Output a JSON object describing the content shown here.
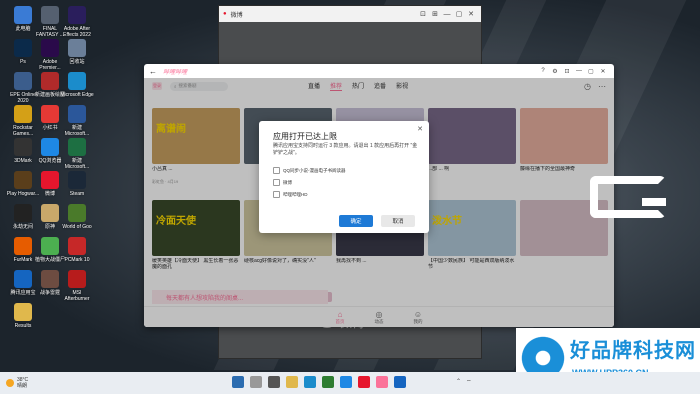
{
  "desktop": {
    "icons": [
      {
        "label": "此电脑",
        "color": "#3a7bd5"
      },
      {
        "label": "FINAL FANTASY ...",
        "color": "#556070"
      },
      {
        "label": "Adobe After Effects 2022",
        "color": "#2a1e5c"
      },
      {
        "label": "Ps",
        "sub": "Adobe Photosh...",
        "color": "#0b2a4a"
      },
      {
        "label": "Adobe Premier...",
        "color": "#2a0a4a"
      },
      {
        "label": "回收站",
        "color": "#6b7f99"
      },
      {
        "label": "EPE Online 2020",
        "color": "#3b5d8c"
      },
      {
        "label": "新建画板绘图",
        "color": "#b02a2a"
      },
      {
        "label": "Microsoft Edge",
        "color": "#1b8ccb"
      },
      {
        "label": "Rockstar Games...",
        "color": "#d4a017"
      },
      {
        "label": "小红书",
        "color": "#e53935"
      },
      {
        "label": "新建 Microsoft...",
        "color": "#2b579a"
      },
      {
        "label": "3DMark",
        "color": "#333333"
      },
      {
        "label": "QQ浏览器",
        "color": "#1e88e5"
      },
      {
        "label": "新建 Microsoft...",
        "color": "#1d6f42"
      },
      {
        "label": "Play Hogwar...",
        "color": "#5a3e1b"
      },
      {
        "label": "微博",
        "color": "#e6162d"
      },
      {
        "label": "Steam",
        "color": "#1b2838"
      },
      {
        "label": "永劫无间",
        "color": "#222222"
      },
      {
        "label": "原神",
        "color": "#c9a86a"
      },
      {
        "label": "World of Goo",
        "color": "#4a7a2a"
      },
      {
        "label": "FurMark",
        "color": "#e65c00"
      },
      {
        "label": "植物大战僵尸",
        "color": "#4caf50"
      },
      {
        "label": "PCMark 10",
        "color": "#c62828"
      },
      {
        "label": "腾讯应用宝",
        "color": "#1565c0"
      },
      {
        "label": "战争雷霆",
        "color": "#6d4c41"
      },
      {
        "label": "MSI Afterburner",
        "color": "#b71c1c"
      },
      {
        "label": "Results",
        "color": "#e0b84c"
      }
    ]
  },
  "weibo_window": {
    "title": "微博",
    "logo_text": "微博",
    "buttons": [
      "⊡",
      "⊞",
      "—",
      "▢",
      "✕"
    ]
  },
  "bili_window": {
    "title": "哔哩哔哩",
    "nav": {
      "avatar": "登录",
      "search_placeholder": "搜索番剧",
      "tabs": [
        "直播",
        "推荐",
        "热门",
        "追番",
        "影视"
      ],
      "active_tab": "推荐"
    },
    "cards": [
      {
        "cap": "离谱闹",
        "title": "小吕真 ...",
        "meta": "彩虹鱼 · 4月19",
        "bg": "#c8a060",
        "capcolor": "#ffdd00"
      },
      {
        "cap": "",
        "title": "",
        "meta": "",
        "bg": "#5a6670",
        "capcolor": "#fff"
      },
      {
        "cap": "",
        "title": "",
        "meta": "",
        "bg": "#c9c2d8",
        "capcolor": "#fff"
      },
      {
        "cap": "",
        "title": "...部 ... 啊",
        "meta": "",
        "bg": "#7a6a8a",
        "capcolor": "#fff"
      },
      {
        "cap": "",
        "title": "藤缘在播下的全国最神奇",
        "meta": "",
        "bg": "#e8b0a0",
        "capcolor": "#fff"
      },
      {
        "cap": "冷面天使",
        "title": "缓笑英雄【冷面天使】 黑生长着一张恶魔的面孔",
        "meta": "",
        "bg": "#3a4a2a",
        "capcolor": "#ffdd00"
      },
      {
        "cap": "",
        "title": "硬核acg好像说对了，确实没\"人\"",
        "meta": "",
        "bg": "#d0c8a0",
        "capcolor": "#fff"
      },
      {
        "cap": "",
        "title": "我再找不到 ...",
        "meta": "",
        "bg": "#3a3a4a",
        "capcolor": "#fff"
      },
      {
        "cap": "泼水节",
        "title": "【中国少数民族】 可能是西双版纳泼水节",
        "meta": "",
        "bg": "#b0c8d8",
        "capcolor": "#ffdd00"
      },
      {
        "cap": "",
        "title": "",
        "meta": "",
        "bg": "#d8c0c8",
        "capcolor": "#fff"
      },
      {
        "cap": "",
        "title": "",
        "meta": "",
        "bg": "#a0b0c0",
        "capcolor": "#fff"
      },
      {
        "cap": "",
        "title": "",
        "meta": "",
        "bg": "#e8c0d0",
        "capcolor": "#fff"
      }
    ],
    "banner": "每天都有人想攻陷我的阁桌...",
    "bottom_nav": [
      {
        "label": "首页",
        "icon": "⌂"
      },
      {
        "label": "动态",
        "icon": "◎"
      },
      {
        "label": "我的",
        "icon": "☺"
      }
    ]
  },
  "dialog": {
    "title": "应用打开已达上限",
    "body": "腾讯应用宝支持同时运行 3 款应用。请退出 1 款应用后再打开 \"金铲铲之战\"。",
    "options": [
      "QQ同步小说-漫画电子书阅读器",
      "微博",
      "哔哩哔哩HD"
    ],
    "ok": "确定",
    "cancel": "取消"
  },
  "watermark": {
    "brand": "好品牌科技网",
    "url": "WWW.HPP360.CN"
  },
  "taskbar": {
    "weather_temp": "38°C",
    "weather_desc": "晴朗"
  }
}
